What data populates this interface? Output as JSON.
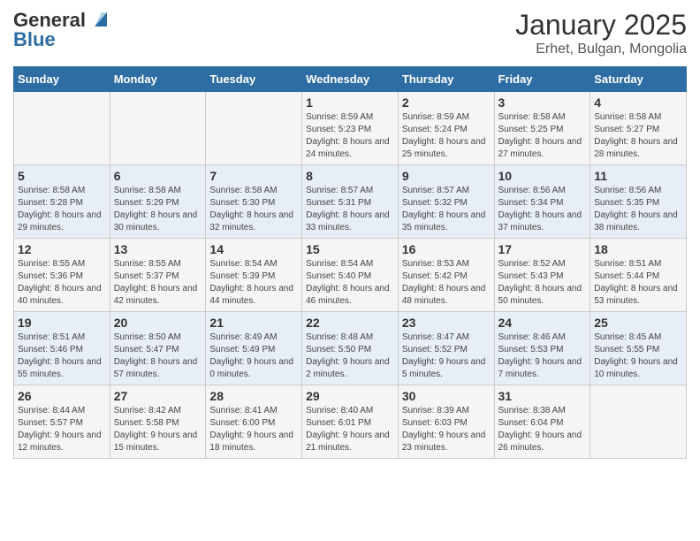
{
  "header": {
    "logo_general": "General",
    "logo_blue": "Blue",
    "month_year": "January 2025",
    "location": "Erhet, Bulgan, Mongolia"
  },
  "days_of_week": [
    "Sunday",
    "Monday",
    "Tuesday",
    "Wednesday",
    "Thursday",
    "Friday",
    "Saturday"
  ],
  "weeks": [
    [
      {
        "day": "",
        "content": ""
      },
      {
        "day": "",
        "content": ""
      },
      {
        "day": "",
        "content": ""
      },
      {
        "day": "1",
        "content": "Sunrise: 8:59 AM\nSunset: 5:23 PM\nDaylight: 8 hours\nand 24 minutes."
      },
      {
        "day": "2",
        "content": "Sunrise: 8:59 AM\nSunset: 5:24 PM\nDaylight: 8 hours\nand 25 minutes."
      },
      {
        "day": "3",
        "content": "Sunrise: 8:58 AM\nSunset: 5:25 PM\nDaylight: 8 hours\nand 27 minutes."
      },
      {
        "day": "4",
        "content": "Sunrise: 8:58 AM\nSunset: 5:27 PM\nDaylight: 8 hours\nand 28 minutes."
      }
    ],
    [
      {
        "day": "5",
        "content": "Sunrise: 8:58 AM\nSunset: 5:28 PM\nDaylight: 8 hours\nand 29 minutes."
      },
      {
        "day": "6",
        "content": "Sunrise: 8:58 AM\nSunset: 5:29 PM\nDaylight: 8 hours\nand 30 minutes."
      },
      {
        "day": "7",
        "content": "Sunrise: 8:58 AM\nSunset: 5:30 PM\nDaylight: 8 hours\nand 32 minutes."
      },
      {
        "day": "8",
        "content": "Sunrise: 8:57 AM\nSunset: 5:31 PM\nDaylight: 8 hours\nand 33 minutes."
      },
      {
        "day": "9",
        "content": "Sunrise: 8:57 AM\nSunset: 5:32 PM\nDaylight: 8 hours\nand 35 minutes."
      },
      {
        "day": "10",
        "content": "Sunrise: 8:56 AM\nSunset: 5:34 PM\nDaylight: 8 hours\nand 37 minutes."
      },
      {
        "day": "11",
        "content": "Sunrise: 8:56 AM\nSunset: 5:35 PM\nDaylight: 8 hours\nand 38 minutes."
      }
    ],
    [
      {
        "day": "12",
        "content": "Sunrise: 8:55 AM\nSunset: 5:36 PM\nDaylight: 8 hours\nand 40 minutes."
      },
      {
        "day": "13",
        "content": "Sunrise: 8:55 AM\nSunset: 5:37 PM\nDaylight: 8 hours\nand 42 minutes."
      },
      {
        "day": "14",
        "content": "Sunrise: 8:54 AM\nSunset: 5:39 PM\nDaylight: 8 hours\nand 44 minutes."
      },
      {
        "day": "15",
        "content": "Sunrise: 8:54 AM\nSunset: 5:40 PM\nDaylight: 8 hours\nand 46 minutes."
      },
      {
        "day": "16",
        "content": "Sunrise: 8:53 AM\nSunset: 5:42 PM\nDaylight: 8 hours\nand 48 minutes."
      },
      {
        "day": "17",
        "content": "Sunrise: 8:52 AM\nSunset: 5:43 PM\nDaylight: 8 hours\nand 50 minutes."
      },
      {
        "day": "18",
        "content": "Sunrise: 8:51 AM\nSunset: 5:44 PM\nDaylight: 8 hours\nand 53 minutes."
      }
    ],
    [
      {
        "day": "19",
        "content": "Sunrise: 8:51 AM\nSunset: 5:46 PM\nDaylight: 8 hours\nand 55 minutes."
      },
      {
        "day": "20",
        "content": "Sunrise: 8:50 AM\nSunset: 5:47 PM\nDaylight: 8 hours\nand 57 minutes."
      },
      {
        "day": "21",
        "content": "Sunrise: 8:49 AM\nSunset: 5:49 PM\nDaylight: 9 hours\nand 0 minutes."
      },
      {
        "day": "22",
        "content": "Sunrise: 8:48 AM\nSunset: 5:50 PM\nDaylight: 9 hours\nand 2 minutes."
      },
      {
        "day": "23",
        "content": "Sunrise: 8:47 AM\nSunset: 5:52 PM\nDaylight: 9 hours\nand 5 minutes."
      },
      {
        "day": "24",
        "content": "Sunrise: 8:46 AM\nSunset: 5:53 PM\nDaylight: 9 hours\nand 7 minutes."
      },
      {
        "day": "25",
        "content": "Sunrise: 8:45 AM\nSunset: 5:55 PM\nDaylight: 9 hours\nand 10 minutes."
      }
    ],
    [
      {
        "day": "26",
        "content": "Sunrise: 8:44 AM\nSunset: 5:57 PM\nDaylight: 9 hours\nand 12 minutes."
      },
      {
        "day": "27",
        "content": "Sunrise: 8:42 AM\nSunset: 5:58 PM\nDaylight: 9 hours\nand 15 minutes."
      },
      {
        "day": "28",
        "content": "Sunrise: 8:41 AM\nSunset: 6:00 PM\nDaylight: 9 hours\nand 18 minutes."
      },
      {
        "day": "29",
        "content": "Sunrise: 8:40 AM\nSunset: 6:01 PM\nDaylight: 9 hours\nand 21 minutes."
      },
      {
        "day": "30",
        "content": "Sunrise: 8:39 AM\nSunset: 6:03 PM\nDaylight: 9 hours\nand 23 minutes."
      },
      {
        "day": "31",
        "content": "Sunrise: 8:38 AM\nSunset: 6:04 PM\nDaylight: 9 hours\nand 26 minutes."
      },
      {
        "day": "",
        "content": ""
      }
    ]
  ]
}
